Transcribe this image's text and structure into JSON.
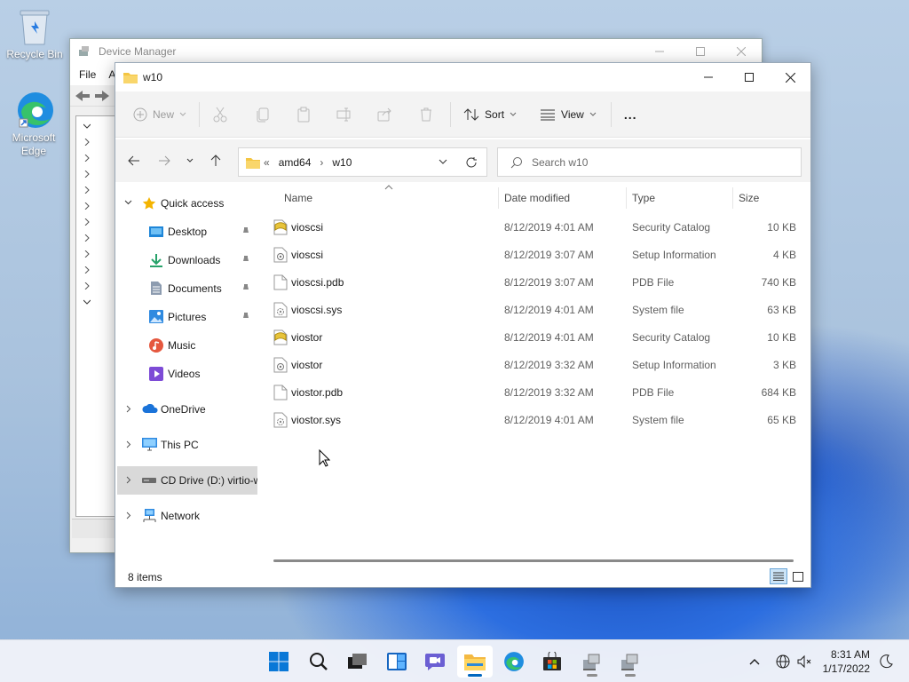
{
  "desktop": {
    "icons": [
      {
        "label": "Recycle Bin",
        "icon": "recycle-bin-icon"
      },
      {
        "label": "Microsoft Edge",
        "icon": "edge-icon"
      }
    ]
  },
  "device_manager": {
    "title": "Device Manager",
    "menu": [
      "File",
      "A"
    ]
  },
  "explorer": {
    "title": "w10",
    "command_bar": {
      "new": "New",
      "sort": "Sort",
      "view": "View",
      "more": "..."
    },
    "address": {
      "overflow": "«",
      "segments": [
        "amd64",
        "w10"
      ]
    },
    "search": {
      "placeholder": "Search w10"
    },
    "nav_pane": [
      {
        "label": "Quick access",
        "icon": "star-icon"
      },
      {
        "label": "Desktop",
        "icon": "desktop-folder-icon",
        "pinned": true
      },
      {
        "label": "Downloads",
        "icon": "downloads-icon",
        "pinned": true
      },
      {
        "label": "Documents",
        "icon": "documents-icon",
        "pinned": true
      },
      {
        "label": "Pictures",
        "icon": "pictures-icon",
        "pinned": true
      },
      {
        "label": "Music",
        "icon": "music-icon"
      },
      {
        "label": "Videos",
        "icon": "videos-icon"
      },
      {
        "label": "OneDrive",
        "icon": "onedrive-icon"
      },
      {
        "label": "This PC",
        "icon": "pc-icon"
      },
      {
        "label": "CD Drive (D:) virtio-w",
        "icon": "cd-drive-icon",
        "selected": true
      },
      {
        "label": "Network",
        "icon": "network-icon"
      }
    ],
    "columns": {
      "name": "Name",
      "date": "Date modified",
      "type": "Type",
      "size": "Size"
    },
    "files": [
      {
        "name": "vioscsi",
        "date": "8/12/2019 4:01 AM",
        "type": "Security Catalog",
        "size": "10 KB",
        "icon": "catalog-file-icon"
      },
      {
        "name": "vioscsi",
        "date": "8/12/2019 3:07 AM",
        "type": "Setup Information",
        "size": "4 KB",
        "icon": "inf-file-icon"
      },
      {
        "name": "vioscsi.pdb",
        "date": "8/12/2019 3:07 AM",
        "type": "PDB File",
        "size": "740 KB",
        "icon": "blank-file-icon"
      },
      {
        "name": "vioscsi.sys",
        "date": "8/12/2019 4:01 AM",
        "type": "System file",
        "size": "63 KB",
        "icon": "sys-file-icon"
      },
      {
        "name": "viostor",
        "date": "8/12/2019 4:01 AM",
        "type": "Security Catalog",
        "size": "10 KB",
        "icon": "catalog-file-icon"
      },
      {
        "name": "viostor",
        "date": "8/12/2019 3:32 AM",
        "type": "Setup Information",
        "size": "3 KB",
        "icon": "inf-file-icon"
      },
      {
        "name": "viostor.pdb",
        "date": "8/12/2019 3:32 AM",
        "type": "PDB File",
        "size": "684 KB",
        "icon": "blank-file-icon"
      },
      {
        "name": "viostor.sys",
        "date": "8/12/2019 4:01 AM",
        "type": "System file",
        "size": "65 KB",
        "icon": "sys-file-icon"
      }
    ],
    "status": {
      "item_count": "8 items"
    }
  },
  "taskbar": {
    "apps": [
      "start-icon",
      "search-icon",
      "task-view-icon",
      "widgets-icon",
      "chat-icon",
      "file-explorer-icon",
      "edge-icon",
      "store-icon",
      "device-manager-icon",
      "device-manager-icon"
    ],
    "clock": {
      "time": "8:31 AM",
      "date": "1/17/2022"
    }
  },
  "colors": {
    "accent": "#0067c0",
    "folder": "#f4c542",
    "selection": "#d9d9d9"
  }
}
